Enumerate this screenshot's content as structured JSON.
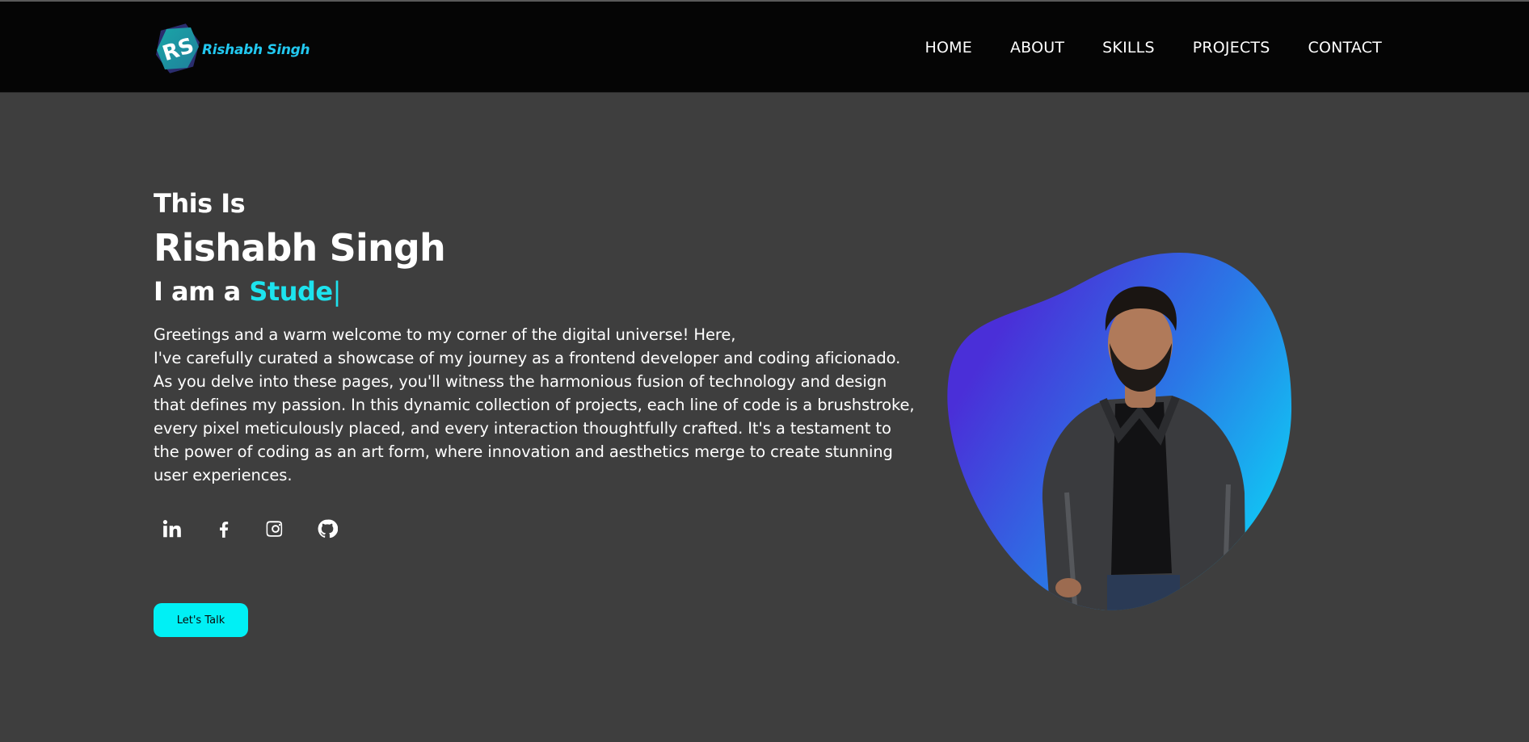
{
  "header": {
    "logo_monogram": "RS",
    "logo_text": "Rishabh Singh",
    "nav": [
      {
        "label": "HOME"
      },
      {
        "label": "ABOUT"
      },
      {
        "label": "SKILLS"
      },
      {
        "label": "PROJECTS"
      },
      {
        "label": "CONTACT"
      }
    ]
  },
  "hero": {
    "intro": "This Is",
    "name": "Rishabh Singh",
    "role_prefix": "I am a ",
    "role_typed": "Stude",
    "cursor": "|",
    "greeting_line1": "Greetings and a warm welcome to my corner of the digital universe! Here,",
    "greeting_body": "I've carefully curated a showcase of my journey as a frontend developer and coding aficionado. As you delve into these pages, you'll witness the harmonious fusion of technology and design that defines my passion. In this dynamic collection of projects, each line of code is a brushstroke, every pixel meticulously placed, and every interaction thoughtfully crafted. It's a testament to the power of coding as an art form, where innovation and aesthetics merge to create stunning user experiences.",
    "socials": [
      {
        "icon": "linkedin-icon"
      },
      {
        "icon": "facebook-icon"
      },
      {
        "icon": "instagram-icon"
      },
      {
        "icon": "github-icon"
      }
    ],
    "cta_label": "Let's Talk"
  },
  "colors": {
    "accent": "#1de3ee",
    "cta": "#00f0f5",
    "background": "#3e3e3e",
    "header": "#050505",
    "blob_start": "#4a2fd8",
    "blob_end": "#12c3f3"
  }
}
